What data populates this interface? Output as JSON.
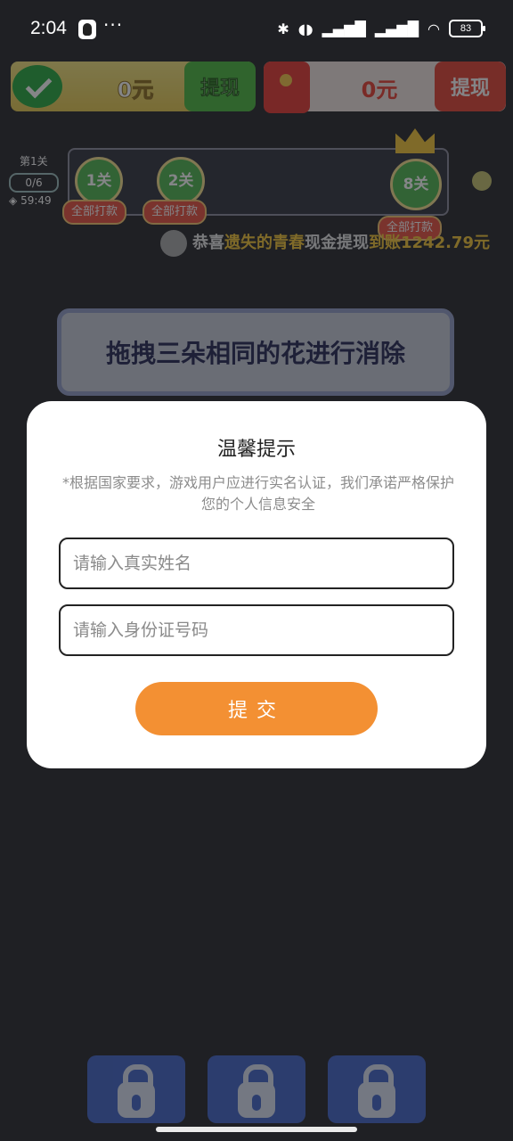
{
  "status_bar": {
    "time": "2:04",
    "dots": "···",
    "battery": "83",
    "icons": [
      "qq-icon",
      "bluetooth-icon",
      "earbuds-icon",
      "signal-hd-icon",
      "signal-hd-icon",
      "wifi-icon",
      "battery-icon"
    ]
  },
  "game": {
    "wallet_left": {
      "amount": "0元",
      "withdraw_label": "提现"
    },
    "wallet_right": {
      "amount": "0元",
      "withdraw_label": "提现"
    },
    "level": {
      "label": "第1关",
      "progress": "0/6",
      "timer": "59:49"
    },
    "milestones": [
      {
        "label": "1关",
        "tag": "全部打款"
      },
      {
        "label": "2关",
        "tag": "全部打款"
      },
      {
        "label": "8关",
        "tag": "全部打款"
      }
    ],
    "ticker": {
      "prefix": "恭喜",
      "name": "遗失的青春",
      "middle": "现金提现",
      "amount": "到账1242.79元"
    },
    "banner": "拖拽三朵相同的花进行消除"
  },
  "modal": {
    "title": "温馨提示",
    "description": "*根据国家要求，游戏用户应进行实名认证，我们承诺严格保护您的个人信息安全",
    "name_placeholder": "请输入真实姓名",
    "id_placeholder": "请输入身份证号码",
    "submit_label": "提交"
  },
  "colors": {
    "accent": "#f39033",
    "overlay_bg": "#1f2024"
  }
}
